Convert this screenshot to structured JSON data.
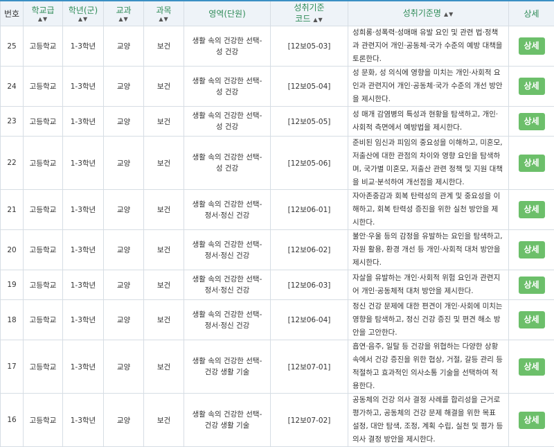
{
  "table": {
    "headers": {
      "number": "번호",
      "school_level": "학교급",
      "grade": "학년(군)",
      "subject_group": "교과",
      "subject": "과목",
      "area": "영역(단원)",
      "code_line1": "성취기준",
      "code_line2": "코드",
      "standard": "성취기준명",
      "detail": "상세",
      "sort_arrows": "▲▼"
    },
    "rows": [
      {
        "number": "25",
        "school_level": "고등학교",
        "grade": "1-3학년",
        "subject_group": "교양",
        "subject": "보건",
        "area": "생활 속의 건강한 선택-성 건강",
        "code": "[12보05-03]",
        "standard": "성희롱·성폭력·성매매 유발 요인 및 관련 법·정책과 관련지어 개인·공동체·국가 수준의 예방 대책을 토론한다.",
        "detail_label": "상세"
      },
      {
        "number": "24",
        "school_level": "고등학교",
        "grade": "1-3학년",
        "subject_group": "교양",
        "subject": "보건",
        "area": "생활 속의 건강한 선택-성 건강",
        "code": "[12보05-04]",
        "standard": "성 문화, 성 의식에 영향을 미치는 개인·사회적 요인과 관련지어 개인·공동체·국가 수준의 개선 방안을 제시한다.",
        "detail_label": "상세"
      },
      {
        "number": "23",
        "school_level": "고등학교",
        "grade": "1-3학년",
        "subject_group": "교양",
        "subject": "보건",
        "area": "생활 속의 건강한 선택-성 건강",
        "code": "[12보05-05]",
        "standard": "성 매개 감염병의 특성과 현황을 탐색하고, 개인·사회적 측면에서 예방법을 제시한다.",
        "detail_label": "상세"
      },
      {
        "number": "22",
        "school_level": "고등학교",
        "grade": "1-3학년",
        "subject_group": "교양",
        "subject": "보건",
        "area": "생활 속의 건강한 선택-성 건강",
        "code": "[12보05-06]",
        "standard": "준비된 임신과 피임의 중요성을 이해하고, 미혼모, 저출산에 대한 관점의 차이와 영향 요인을 탐색하며, 국가별 미혼모, 저출산 관련 정책 및 지원 대책을 비교·분석하여 개선점을 제시한다.",
        "detail_label": "상세"
      },
      {
        "number": "21",
        "school_level": "고등학교",
        "grade": "1-3학년",
        "subject_group": "교양",
        "subject": "보건",
        "area": "생활 속의 건강한 선택-정서·정신 건강",
        "code": "[12보06-01]",
        "standard": "자아존중감과 회복 탄력성의 관계 및 중요성을 이해하고, 회복 탄력성 증진을 위한 실천 방안을 제시한다.",
        "detail_label": "상세"
      },
      {
        "number": "20",
        "school_level": "고등학교",
        "grade": "1-3학년",
        "subject_group": "교양",
        "subject": "보건",
        "area": "생활 속의 건강한 선택-정서·정신 건강",
        "code": "[12보06-02]",
        "standard": "불안·우울 등의 감정을 유발하는 요인을 탐색하고, 자원 활용, 환경 개선 등 개인·사회적 대처 방안을 제시한다.",
        "detail_label": "상세"
      },
      {
        "number": "19",
        "school_level": "고등학교",
        "grade": "1-3학년",
        "subject_group": "교양",
        "subject": "보건",
        "area": "생활 속의 건강한 선택-정서·정신 건강",
        "code": "[12보06-03]",
        "standard": "자살을 유발하는 개인·사회적 위험 요인과 관련지어 개인·공동체적 대처 방안을 제시한다.",
        "detail_label": "상세"
      },
      {
        "number": "18",
        "school_level": "고등학교",
        "grade": "1-3학년",
        "subject_group": "교양",
        "subject": "보건",
        "area": "생활 속의 건강한 선택-정서·정신 건강",
        "code": "[12보06-04]",
        "standard": "정신 건강 문제에 대한 편견이 개인·사회에 미치는 영향을 탐색하고, 정신 건강 증진 및 편견 해소 방안을 고안한다.",
        "detail_label": "상세"
      },
      {
        "number": "17",
        "school_level": "고등학교",
        "grade": "1-3학년",
        "subject_group": "교양",
        "subject": "보건",
        "area": "생활 속의 건강한 선택-건강 생활 기술",
        "code": "[12보07-01]",
        "standard": "흡연·음주, 일탈 등 건강을 위협하는 다양한 상황 속에서 건강 증진을 위한 협상, 거절, 갈등 관리 등 적절하고 효과적인 의사소통 기술을 선택하여 적용한다.",
        "detail_label": "상세"
      },
      {
        "number": "16",
        "school_level": "고등학교",
        "grade": "1-3학년",
        "subject_group": "교양",
        "subject": "보건",
        "area": "생활 속의 건강한 선택-건강 생활 기술",
        "code": "[12보07-02]",
        "standard": "공동체의 건강 의사 결정 사례를 합리성을 근거로 평가하고, 공동체의 건강 문제 해결을 위한 목표 설정, 대안 탐색, 조정, 계획 수립, 실천 및 평가 등 의사 결정 방안을 제시한다.",
        "detail_label": "상세"
      }
    ]
  }
}
